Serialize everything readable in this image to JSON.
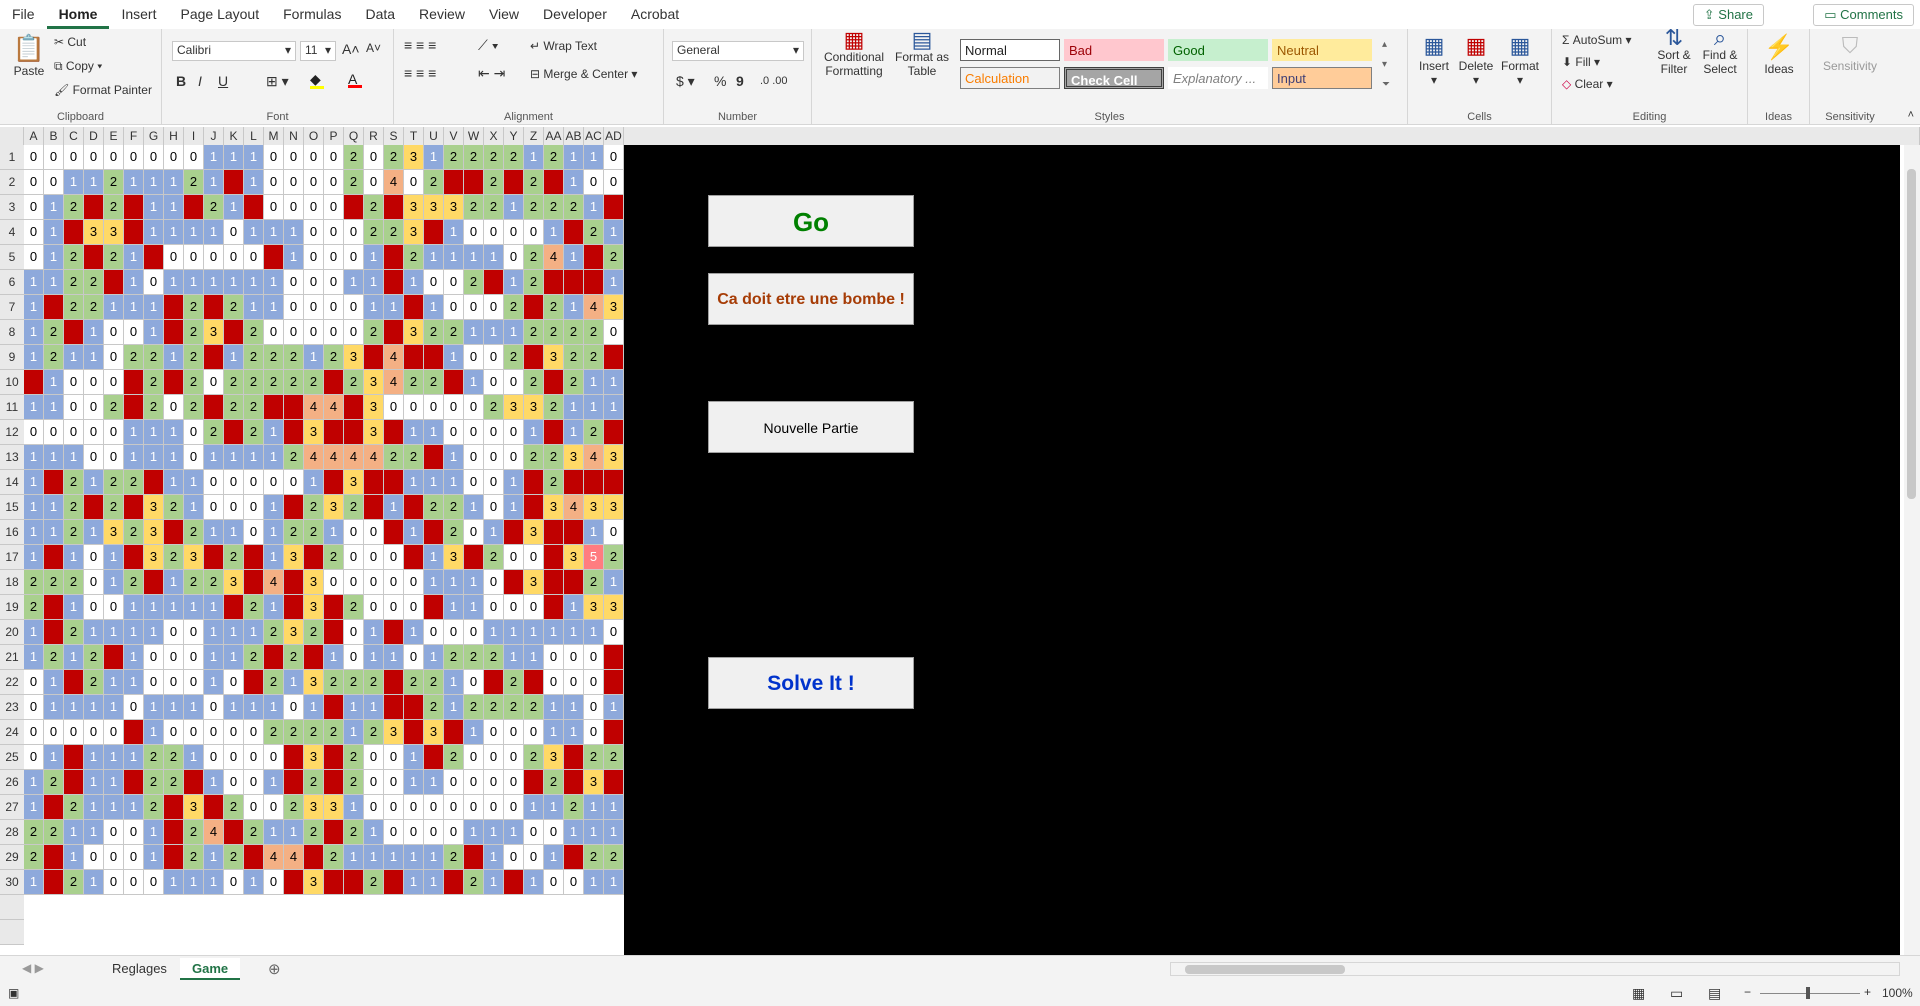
{
  "menu": {
    "tabs": [
      "File",
      "Home",
      "Insert",
      "Page Layout",
      "Formulas",
      "Data",
      "Review",
      "View",
      "Developer",
      "Acrobat"
    ],
    "active": "Home",
    "share_label": "Share",
    "comments_label": "Comments"
  },
  "ribbon": {
    "clipboard": {
      "paste": "Paste",
      "cut": "Cut",
      "copy": "Copy",
      "format_painter": "Format Painter",
      "label": "Clipboard"
    },
    "font": {
      "name": "Calibri",
      "size": "11",
      "label": "Font",
      "bold": "B",
      "italic": "I",
      "underline": "U"
    },
    "alignment": {
      "wrap": "Wrap Text",
      "merge": "Merge & Center",
      "label": "Alignment"
    },
    "number": {
      "format": "General",
      "label": "Number",
      "currency": "$",
      "percent": "%",
      "comma": "9"
    },
    "styles": {
      "conditional": "Conditional Formatting",
      "format_table": "Format as Table",
      "normal": "Normal",
      "bad": "Bad",
      "good": "Good",
      "neutral": "Neutral",
      "calculation": "Calculation",
      "check": "Check Cell",
      "explanatory": "Explanatory ...",
      "input": "Input",
      "label": "Styles"
    },
    "cells": {
      "insert": "Insert",
      "delete": "Delete",
      "format": "Format",
      "label": "Cells"
    },
    "editing": {
      "autosum": "AutoSum",
      "fill": "Fill",
      "clear": "Clear",
      "sort": "Sort & Filter",
      "find": "Find & Select",
      "label": "Editing"
    },
    "ideas": {
      "ideas": "Ideas",
      "label": "Ideas"
    },
    "sensitivity": {
      "sensitivity": "Sensitivity",
      "label": "Sensitivity"
    }
  },
  "columns": [
    "A",
    "B",
    "C",
    "D",
    "E",
    "F",
    "G",
    "H",
    "I",
    "J",
    "K",
    "L",
    "M",
    "N",
    "O",
    "P",
    "Q",
    "R",
    "S",
    "T",
    "U",
    "V",
    "W",
    "X",
    "Y",
    "Z",
    "AA",
    "AB",
    "AC",
    "AD"
  ],
  "rows": [
    "0000000001110000202312222121100",
    "0011211121.1000020402..2.2.100",
    "012.2.11.21.0000.2.3332212221.0",
    "01.33.11110111000223.100001.21",
    "012.21.00000.10001.211110241.2",
    "1122.1011111100011.1002.12...1",
    "1.22111.2.211000011.10002.21432",
    "12.1001.23.2000002.322111222202",
    "121102212.1222123.4..1002.322..",
    ".1000.2.2022222.23422.1002.2111",
    "11002.202.22..44.3000002332111",
    "0000011102.21.3..3.1100001.12.2",
    "11100111011112444422.1000223433",
    "1.2122.11000001.3..111001.2...2",
    "112.2.3210001.232.1.22101.34331",
    "1121323.2110122100.1.201.3..10",
    "1.101.323.2.13.2000.13.200.3521.0",
    "222012.1223.4.3000001110.3..210",
    "2.10011111.21.3.2000.11000.133.10",
    "1.2111100111232.01.10001111110",
    "1212.1000112.2.10110122211000",
    "01.21100010.213222.2210.2.000",
    "011110111011101.11..21222211011",
    "00000.1000002222123.3.1000110.",
    "01.1112210000.3.2001.200023.22",
    "12.11.22.1001.2.200110000.2.3.1",
    "1.21112.3.200233100000000112111",
    "2211001.24.2112.2100001110011101",
    "2.10001.212.44.2111112.1001.22.",
    "1.21000111010.3..2.11.21.100112.2"
  ],
  "buttons": {
    "go": "Go",
    "bomb": "Ca doit etre une bombe !",
    "new_game": "Nouvelle Partie",
    "solve": "Solve It !"
  },
  "sheets": [
    "Reglages",
    "Game"
  ],
  "active_sheet": "Game",
  "zoom": "100%"
}
